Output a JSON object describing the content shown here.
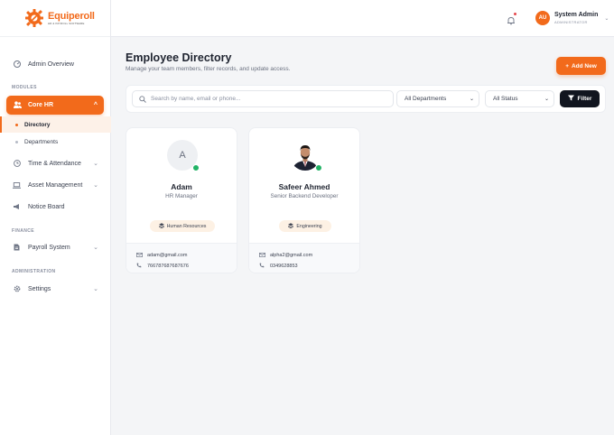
{
  "brand": {
    "name": "Equiperoll",
    "tagline": "HR & PAYROLL SOFTWARE",
    "accent": "#f26a1b"
  },
  "sidebar": {
    "overview": "Admin Overview",
    "sections": {
      "modules": "MODULES",
      "finance": "FINANCE",
      "administration": "ADMINISTRATION"
    },
    "core_hr": "Core HR",
    "sub_items": [
      "Directory",
      "Departments"
    ],
    "items": {
      "time": "Time & Attendance",
      "assets": "Asset Management",
      "notice": "Notice Board",
      "payroll": "Payroll System",
      "settings": "Settings"
    }
  },
  "topbar": {
    "user_initials": "AU",
    "user_name": "System Admin",
    "user_role": "ADMINISTRATOR"
  },
  "main": {
    "title": "Employee Directory",
    "subtitle": "Manage your team members, filter records, and update access.",
    "add_button": "Add New",
    "search_placeholder": "Search by name, email or phone...",
    "department_select": "All Departments",
    "status_select": "All Status",
    "filter_button": "Filter"
  },
  "employees": [
    {
      "initial": "A",
      "name": "Adam",
      "role": "HR Manager",
      "department": "Human Resources",
      "email": "adam@gmail.com",
      "phone": "766787687687676",
      "status_color": "#22b366"
    },
    {
      "initial": "",
      "name": "Safeer Ahmed",
      "role": "Senior Backend Developer",
      "department": "Engineering",
      "email": "alpha2@gmail.com",
      "phone": "0349628853",
      "status_color": "#22b366"
    }
  ]
}
